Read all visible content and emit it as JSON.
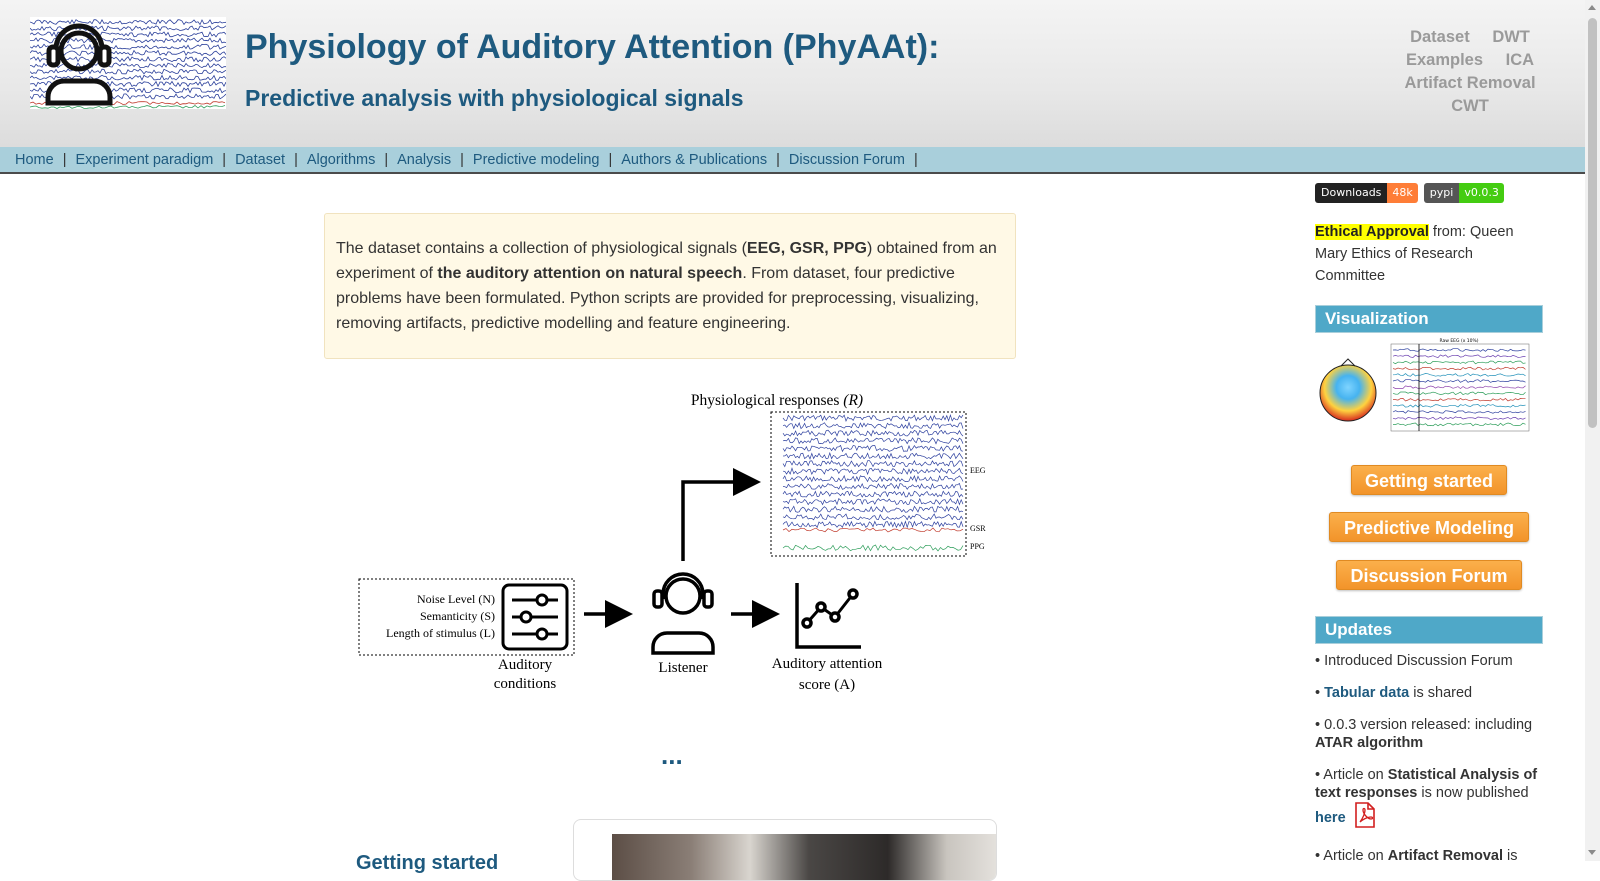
{
  "header": {
    "title": "Physiology of Auditory Attention (PhyAAt):",
    "subtitle": "Predictive analysis with physiological signals",
    "links": [
      "Dataset",
      "DWT",
      "Examples",
      "ICA",
      "Artifact Removal",
      "CWT"
    ]
  },
  "nav": {
    "items": [
      "Home",
      "Experiment paradigm",
      "Dataset",
      "Algorithms",
      "Analysis",
      "Predictive modeling",
      "Authors & Publications",
      "Discussion Forum"
    ],
    "separator": "|"
  },
  "intro": {
    "p1": "The dataset contains a collection of physiological signals (",
    "b1": "EEG, GSR, PPG",
    "p2": ") obtained from an experiment of ",
    "b2": "the auditory attention on natural speech",
    "p3": ". From dataset, four predictive problems have been formulated. Python scripts are provided for preprocessing, visualizing, removing artifacts, predictive modelling and feature engineering."
  },
  "figure": {
    "responses_title": "Physiological responses",
    "responses_symbol": "(R)",
    "channel_labels": [
      "EEG",
      "GSR",
      "PPG"
    ],
    "conditions": [
      "Noise Level (N)",
      "Semanticity (S)",
      "Length of stimulus (L)"
    ],
    "conditions_label_1": "Auditory",
    "conditions_label_2": "conditions",
    "listener_label": "Listener",
    "score_label_1": "Auditory attention",
    "score_label_2": "score (A)"
  },
  "ellipsis": "...",
  "getting_started_heading": "Getting started",
  "sidebar": {
    "badges": [
      {
        "left": "Downloads",
        "right": "48k",
        "color": "#fe7d37"
      },
      {
        "left": "pypi",
        "right": "v0.0.3",
        "color": "#44cc11"
      }
    ],
    "ethics_highlight": "Ethical Approval",
    "ethics_text": " from: Queen Mary Ethics of Research Committee",
    "viz_heading": "Visualization",
    "viz_plot_title": "Raw EEG (x 10%)",
    "buttons": [
      "Getting started",
      "Predictive Modeling",
      "Discussion Forum"
    ],
    "updates_heading": "Updates",
    "updates": {
      "u1": "• Introduced Discussion Forum",
      "u2_pre": "• ",
      "u2_link": "Tabular data",
      "u2_post": " is shared",
      "u3_pre": "• 0.0.3 version released: including ",
      "u3_bold": "ATAR algorithm",
      "u4_pre": "• Article on ",
      "u4_bold": "Statistical Analysis of text responses",
      "u4_post": " is now published",
      "u4_link": "here",
      "u5_pre": "• Article on ",
      "u5_bold": "Artifact Removal",
      "u5_post": " is"
    }
  },
  "colors": {
    "brand": "#1e5a7f",
    "nav_bg": "#a9cfdb",
    "button": "#f2942a",
    "sidebar_heading": "#4fa8c8",
    "highlight": "#ffff00"
  }
}
